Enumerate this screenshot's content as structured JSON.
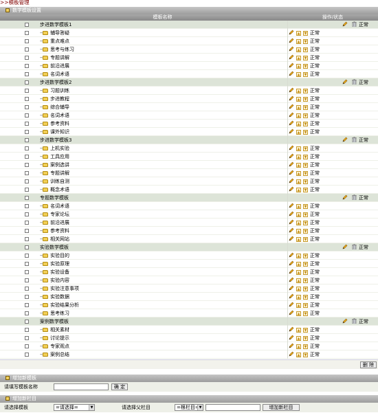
{
  "breadcrumb": ">>模板管理",
  "section1": {
    "title": "数学模板设置"
  },
  "columns": {
    "name": "模板名称",
    "ops": "操作/状态"
  },
  "status_text": "正常",
  "groups": [
    {
      "name": "步进数学模板1",
      "items": [
        "辅导答疑",
        "重点难点",
        "思考与练习",
        "专题讲解",
        "前沿进展",
        "名词术语"
      ]
    },
    {
      "name": "步进数学模板2",
      "items": [
        "习题训练",
        "步进教程",
        "综合辅导",
        "名词术语",
        "参考资料",
        "课外知识"
      ]
    },
    {
      "name": "步进数学模板3",
      "items": [
        "上机实验",
        "工具应用",
        "案例选讲",
        "专题讲解",
        "训练自测",
        "概念术语"
      ]
    },
    {
      "name": "专题数学模板",
      "items": [
        "名词术语",
        "专家论坛",
        "前沿进展",
        "参考资料",
        "相关网站"
      ]
    },
    {
      "name": "实验数学模板",
      "items": [
        "实验目的",
        "实验原理",
        "实验设备",
        "实验内容",
        "实验注意事项",
        "实验数据",
        "实验结果分析",
        "思考练习"
      ]
    },
    {
      "name": "案例数学模板",
      "items": [
        "相关素材",
        "讨论提示",
        "专家观点",
        "案例总结"
      ]
    }
  ],
  "delete_label": "删 除",
  "section2": {
    "title": "增加新模板"
  },
  "new_template": {
    "label": "请填写模板名称",
    "value": "",
    "confirm_label": "确 定"
  },
  "section3": {
    "title": "增加新栏目"
  },
  "new_column": {
    "template_label": "请选择模板",
    "template_select": "=请选择=",
    "parent_label": "请选择父栏目",
    "parent_select": "=根栏目=",
    "name_value": "",
    "add_label": "增加新栏目"
  }
}
